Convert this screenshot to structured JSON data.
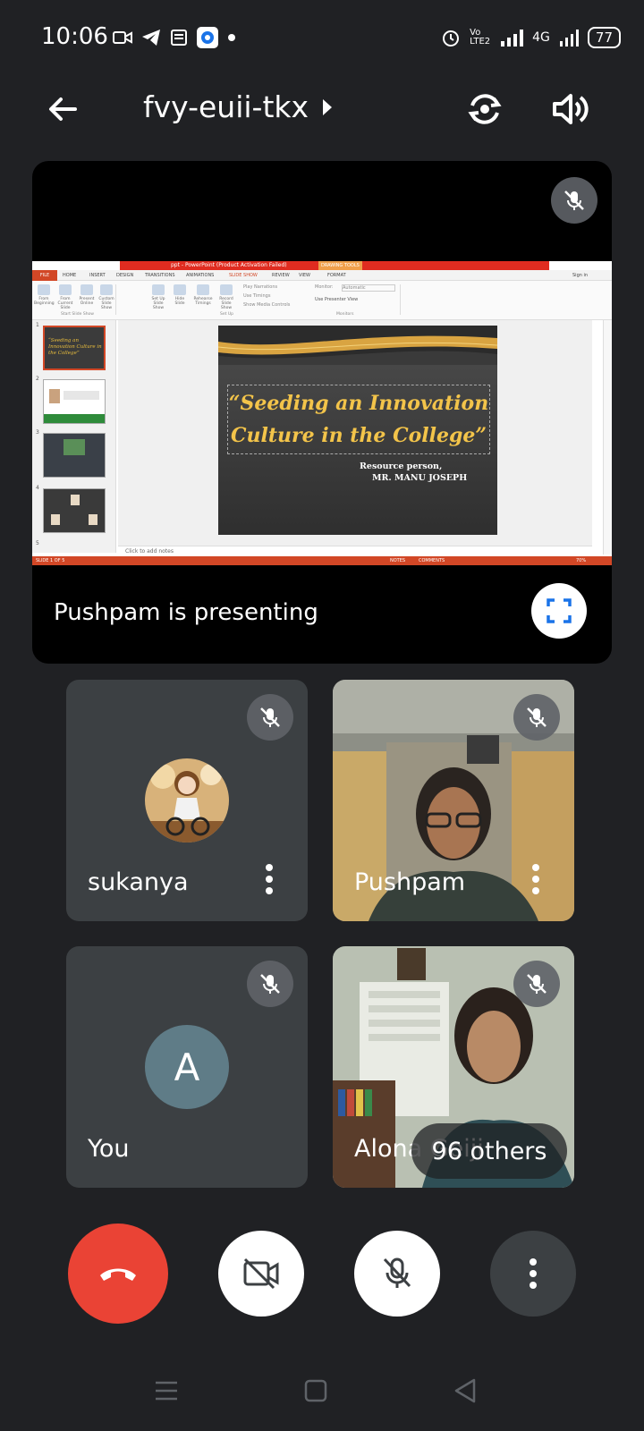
{
  "status_bar": {
    "time": "10:06",
    "network": "4G",
    "volte": "Vo LTE2",
    "battery": "77"
  },
  "header": {
    "meeting_code": "fvy-euii-tkx"
  },
  "presentation": {
    "ppt_title": "ppt - PowerPoint (Product Activation Failed)",
    "drawing_tools": "DRAWING TOOLS",
    "sign_in": "Sign in",
    "tabs": [
      "FILE",
      "HOME",
      "INSERT",
      "DESIGN",
      "TRANSITIONS",
      "ANIMATIONS",
      "SLIDE SHOW",
      "REVIEW",
      "VIEW",
      "FORMAT"
    ],
    "ribbon_buttons": [
      "From Beginning",
      "From Current Slide",
      "Present Online",
      "Custom Slide Show",
      "Set Up Slide Show",
      "Hide Slide",
      "Rehearse Timings",
      "Record Slide Show"
    ],
    "ribbon_checks": [
      "Play Narrations",
      "Use Timings",
      "Show Media Controls"
    ],
    "monitor_label": "Monitor:",
    "monitor_value": "Automatic",
    "use_presenter_view": "Use Presenter View",
    "group_labels": [
      "Start Slide Show",
      "Set Up",
      "Monitors"
    ],
    "slide_title": "“Seeding an Innovation Culture in the College”",
    "slide_subtitle_1": "Resource person,",
    "slide_subtitle_2": "MR. MANU JOSEPH",
    "thumb1_text": "“Seeding an Innovation Culture in the College”",
    "thumb_numbers": [
      "1",
      "2",
      "3",
      "4",
      "5"
    ],
    "notes_placeholder": "Click to add notes",
    "status_text": "SLIDE 1 OF 5",
    "zoom": "70%",
    "notes_label": "NOTES",
    "comments_label": "COMMENTS",
    "presenting_text": "Pushpam is presenting"
  },
  "participants": [
    {
      "name": "sukanya"
    },
    {
      "name": "Pushpam"
    },
    {
      "name": "You",
      "initial": "A"
    },
    {
      "name": "Alona Geiji"
    }
  ],
  "others_count_label": "96 others",
  "colors": {
    "end_call": "#ea4335",
    "background": "#202124",
    "tile": "#3c4043",
    "avatar": "#5f7c87"
  }
}
